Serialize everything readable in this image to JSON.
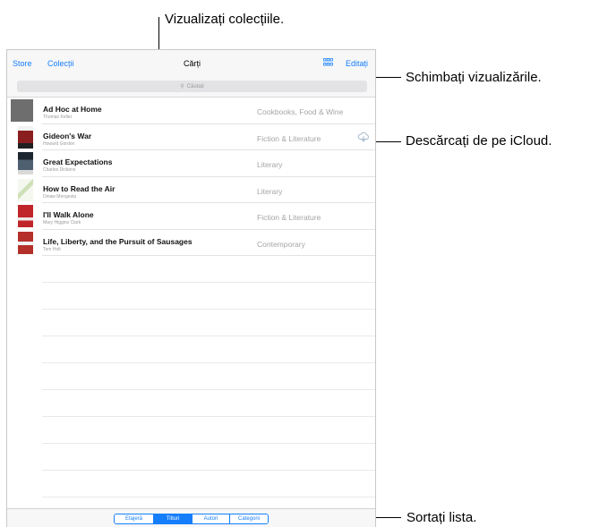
{
  "callouts": {
    "collections": "Vizualizați colecțiile.",
    "views": "Schimbați vizualizările.",
    "download": "Descărcați de pe iCloud.",
    "sort": "Sortați lista."
  },
  "navbar": {
    "store": "Store",
    "collections": "Colecții",
    "title": "Cărți",
    "edit": "Editați",
    "grid_icon": "grid-icon"
  },
  "search": {
    "placeholder": "Căutați",
    "icon": "search-icon"
  },
  "books": [
    {
      "title": "Ad Hoc at Home",
      "author": "Thomas Keller",
      "genre": "Cookbooks, Food & Wine",
      "cover_color": "#6e6e6e"
    },
    {
      "title": "Gideon's War",
      "author": "Howard Gordon",
      "genre": "Fiction & Literature",
      "cover_color": "#8b1e1e",
      "cloud": true
    },
    {
      "title": "Great Expectations",
      "author": "Charles Dickens",
      "genre": "Literary",
      "cover_color": "#3a4a5a"
    },
    {
      "title": "How to Read the Air",
      "author": "Dinaw Mengestu",
      "genre": "Literary",
      "cover_color": "#d8e6c8"
    },
    {
      "title": "I'll Walk Alone",
      "author": "Mary Higgins Clark",
      "genre": "Fiction & Literature",
      "cover_color": "#c0252a"
    },
    {
      "title": "Life, Liberty, and the Pursuit of Sausages",
      "author": "Tom Holt",
      "genre": "Contemporary",
      "cover_color": "#b5302a"
    }
  ],
  "tabs": [
    {
      "label": "Etajeră",
      "active": false
    },
    {
      "label": "Titluri",
      "active": true
    },
    {
      "label": "Autori",
      "active": false
    },
    {
      "label": "Categorii",
      "active": false
    }
  ],
  "colors": {
    "accent": "#157efb",
    "genre": "#a5a5a5"
  }
}
